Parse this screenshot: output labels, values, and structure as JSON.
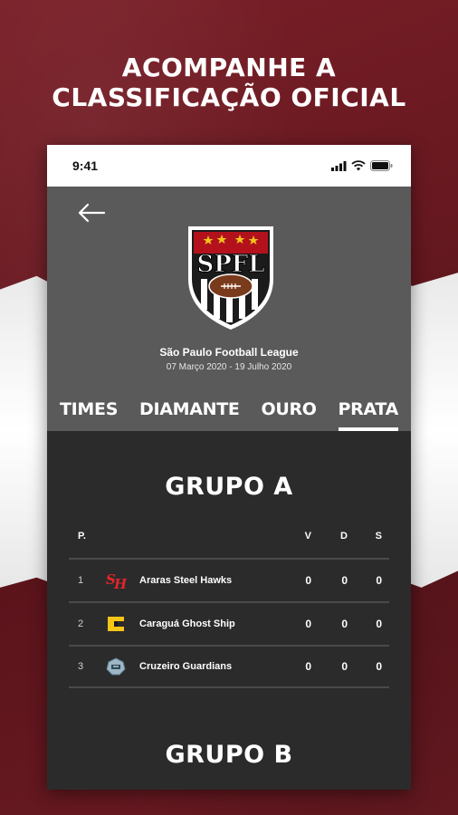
{
  "headline": {
    "line1": "ACOMPANHE A",
    "line2": "CLASSIFICAÇÃO OFICIAL"
  },
  "status_bar": {
    "time": "9:41"
  },
  "league": {
    "logo_text": "SPFL",
    "name": "São Paulo Football League",
    "dates": "07 Março 2020 - 19 Julho 2020"
  },
  "tabs": [
    {
      "label": "TIMES",
      "active": false
    },
    {
      "label": "DIAMANTE",
      "active": false
    },
    {
      "label": "OURO",
      "active": false
    },
    {
      "label": "PRATA",
      "active": true
    }
  ],
  "groups": [
    {
      "title": "GRUPO A",
      "columns": {
        "pos": "P.",
        "v": "V",
        "d": "D",
        "s": "S"
      },
      "rows": [
        {
          "pos": "1",
          "team": "Araras Steel Hawks",
          "logo": "steel-hawks-logo",
          "v": "0",
          "d": "0",
          "s": "0"
        },
        {
          "pos": "2",
          "team": "Caraguá Ghost Ship",
          "logo": "ghost-ship-logo",
          "v": "0",
          "d": "0",
          "s": "0"
        },
        {
          "pos": "3",
          "team": "Cruzeiro Guardians",
          "logo": "guardians-logo",
          "v": "0",
          "d": "0",
          "s": "0"
        }
      ]
    },
    {
      "title": "GRUPO B"
    }
  ],
  "colors": {
    "accent": "#6e1a22",
    "header_bg": "#5a5a5a",
    "content_bg": "#2b2b2b"
  }
}
